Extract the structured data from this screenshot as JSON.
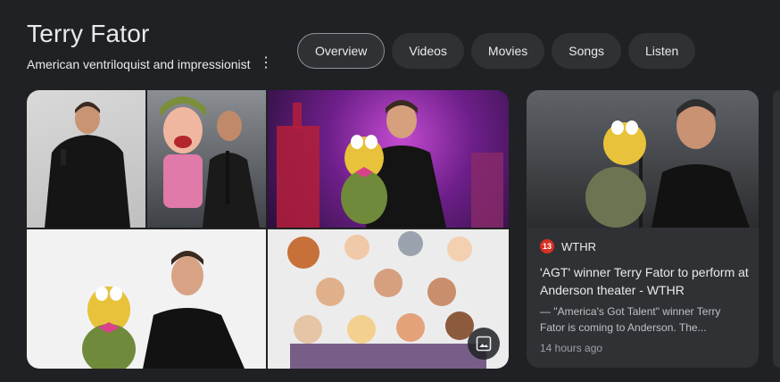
{
  "entity": {
    "title": "Terry Fator",
    "subtitle": "American ventriloquist and impressionist"
  },
  "tabs": [
    {
      "label": "Overview",
      "active": true
    },
    {
      "label": "Videos",
      "active": false
    },
    {
      "label": "Movies",
      "active": false
    },
    {
      "label": "Songs",
      "active": false
    },
    {
      "label": "Listen",
      "active": false
    }
  ],
  "icons": {
    "more": "more-vert-icon",
    "image_search": "image-icon"
  },
  "news": {
    "source": "WTHR",
    "source_logo_text": "13",
    "headline": "'AGT' winner Terry Fator to perform at Anderson theater - WTHR",
    "snippet": "— \"America's Got Talent\" winner Terry Fator is coming to Anderson. The...",
    "time": "14 hours ago"
  },
  "colors": {
    "background": "#202124",
    "chip": "#303134",
    "text": "#e8eaed",
    "muted": "#9aa0a6",
    "source_logo": "#d93025"
  }
}
